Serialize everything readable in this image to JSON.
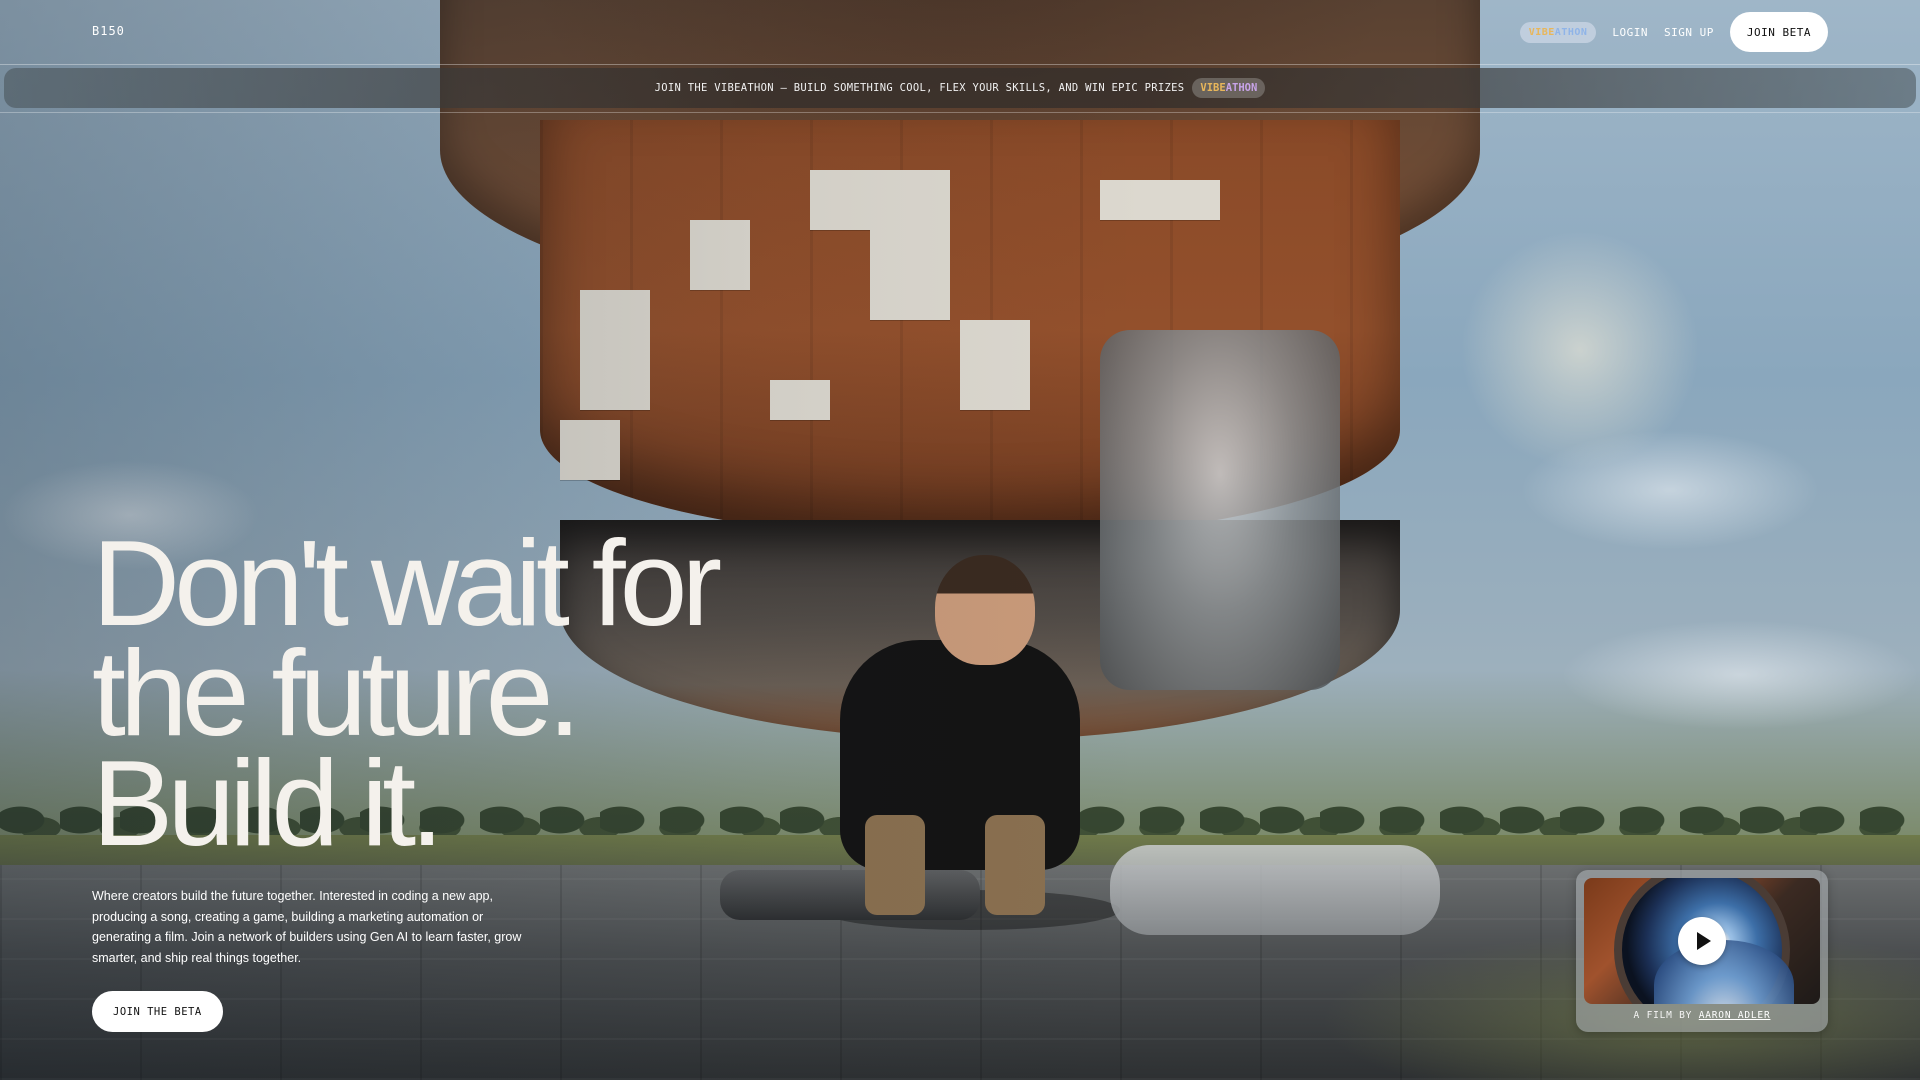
{
  "nav": {
    "logo": "B150",
    "vibe_pill": {
      "part1": "VIBE",
      "part2": "ATHON"
    },
    "login": "LOGIN",
    "signup": "SIGN UP",
    "join_beta": "JOIN BETA"
  },
  "banner": {
    "text": "JOIN THE VIBEATHON — BUILD SOMETHING COOL, FLEX YOUR SKILLS, AND WIN EPIC PRIZES",
    "pill": {
      "part1": "VIBE",
      "part2": "ATHON"
    }
  },
  "hero": {
    "title_lines": [
      "Don't wait for",
      "the future.",
      "Build it."
    ],
    "description": "Where creators build the future together. Interested in coding a new app, producing a song, creating a game, building a marketing automation or generating a film. Join a network of builders using Gen AI to learn faster, grow smarter, and ship real things together.",
    "cta": "JOIN THE BETA"
  },
  "film": {
    "caption_prefix": "A FILM BY",
    "author": "AARON ADLER",
    "play_icon": "play-icon"
  },
  "colors": {
    "hero_text": "#f4f1ec",
    "button_bg": "#ffffff",
    "button_text": "#111111",
    "vibe_gold": "#e8b65a",
    "vibe_blue": "#8fb4e8",
    "vibe_violet": "#c7a3e8"
  }
}
